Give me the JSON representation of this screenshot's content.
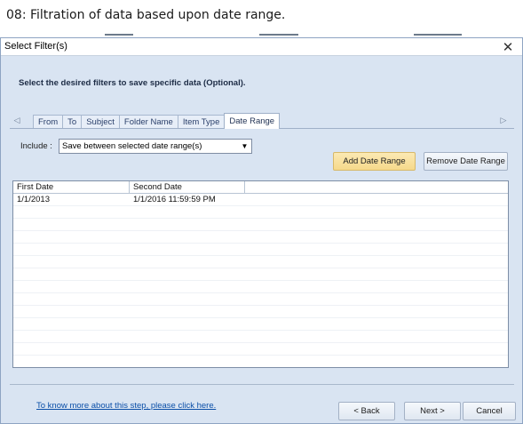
{
  "caption": "08: Filtration of data based upon date range.",
  "dialog": {
    "title": "Select Filter(s)",
    "close_glyph": "✕",
    "instruction": "Select the desired filters to save specific data (Optional).",
    "tabs": [
      {
        "label": "From",
        "active": false
      },
      {
        "label": "To",
        "active": false
      },
      {
        "label": "Subject",
        "active": false
      },
      {
        "label": "Folder Name",
        "active": false
      },
      {
        "label": "Item Type",
        "active": false
      },
      {
        "label": "Date Range",
        "active": true
      }
    ],
    "tab_scroll_left_glyph": "◁",
    "tab_scroll_right_glyph": "▷",
    "include": {
      "label": "Include :",
      "selected": "Save between selected date range(s)",
      "arrow_glyph": "▼"
    },
    "add_button": "Add Date Range",
    "remove_button": "Remove Date Range",
    "grid": {
      "columns": [
        "First Date",
        "Second Date",
        ""
      ],
      "rows": [
        {
          "first": "1/1/2013",
          "second": "1/1/2016 11:59:59 PM"
        }
      ]
    },
    "help_link": "To know more about this step, please click here.",
    "back_button": "< Back",
    "next_button": "Next >",
    "cancel_button": "Cancel"
  },
  "colors": {
    "dialog_bg": "#d9e4f2",
    "highlight_button": "#f6d98b",
    "link": "#0b4fa8"
  }
}
